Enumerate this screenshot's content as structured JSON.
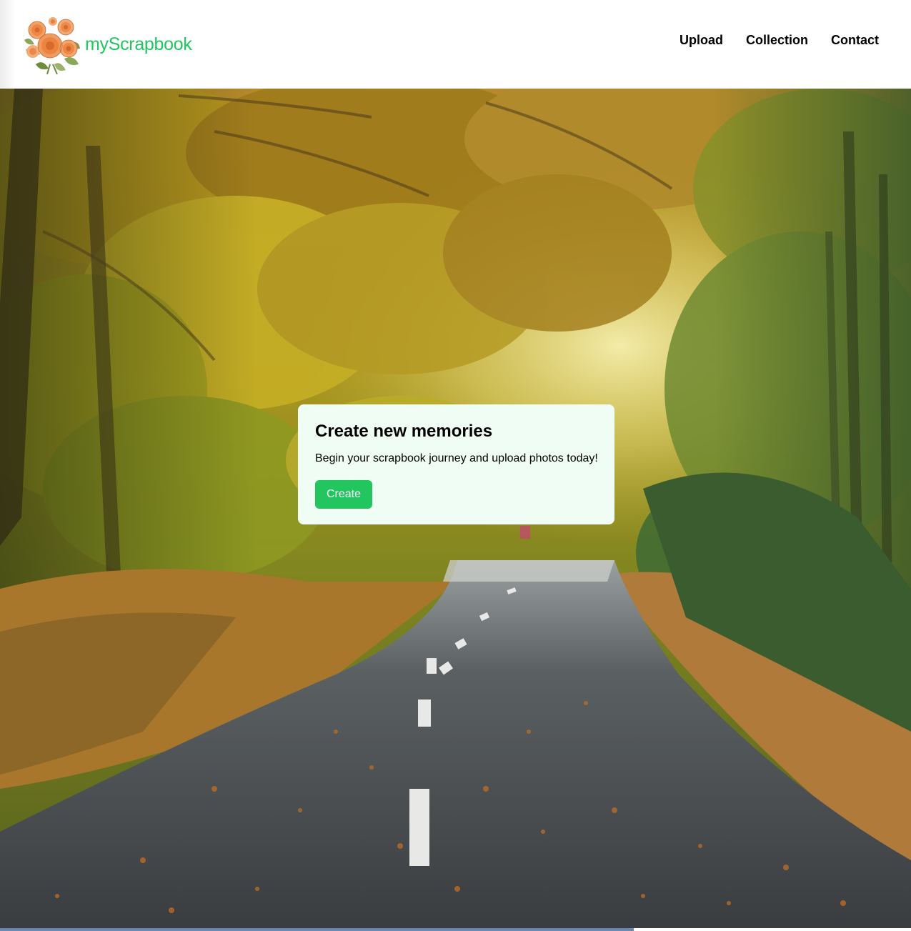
{
  "brand": {
    "name": "myScrapbook",
    "logo_icon": "flower-bouquet-icon",
    "color": "#22c55e"
  },
  "nav": {
    "items": [
      {
        "label": "Upload"
      },
      {
        "label": "Collection"
      },
      {
        "label": "Contact"
      }
    ]
  },
  "hero": {
    "image": "autumn-forest-road"
  },
  "card": {
    "title": "Create new memories",
    "text": "Begin your scrapbook journey and upload photos today!",
    "button_label": "Create",
    "background": "#f0fdf4",
    "button_color": "#22c55e"
  }
}
